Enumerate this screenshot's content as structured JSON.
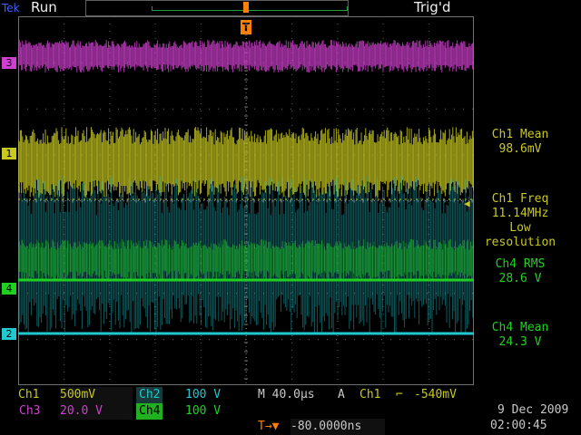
{
  "header": {
    "logo": "Tek",
    "run_status": "Run",
    "trigger_status": "Trig'd",
    "trigger_marker": "T"
  },
  "channel_markers": [
    {
      "label": "3",
      "color": "#d040d0"
    },
    {
      "label": "1",
      "color": "#c8c820"
    },
    {
      "label": "4",
      "color": "#20d020"
    },
    {
      "label": "2",
      "color": "#20c8d0"
    }
  ],
  "measurements": [
    {
      "lines": [
        "Ch1 Mean",
        "98.6mV"
      ],
      "color": "#c8c820"
    },
    {
      "lines": [
        "Ch1 Freq",
        "11.14MHz",
        "Low",
        "resolution"
      ],
      "color": "#c8c820"
    },
    {
      "lines": [
        "Ch4 RMS",
        "28.6 V"
      ],
      "color": "#20d020"
    },
    {
      "lines": [
        "Ch4 Mean",
        "24.3 V"
      ],
      "color": "#20d020"
    }
  ],
  "bottom": {
    "ch1_label": "Ch1",
    "ch1_scale": "500mV",
    "ch2_label": "Ch2",
    "ch2_scale": "100 V",
    "ch3_label": "Ch3",
    "ch3_scale": "20.0 V",
    "ch4_label": "Ch4",
    "ch4_scale": "100 V",
    "timebase": "M 40.0µs",
    "trigger_mode": "A",
    "trigger_source": "Ch1",
    "trigger_slope": "⌐",
    "trigger_level": "-540mV",
    "trigger_position": "-80.0000ns",
    "trigger_pos_icon": "T→▼",
    "date": "9 Dec  2009",
    "time": "02:00:45"
  },
  "colors": {
    "ch1": "#c8c820",
    "ch2": "#20c8d0",
    "ch3": "#d040d0",
    "ch4": "#20d020",
    "trigger": "#ff8000"
  }
}
